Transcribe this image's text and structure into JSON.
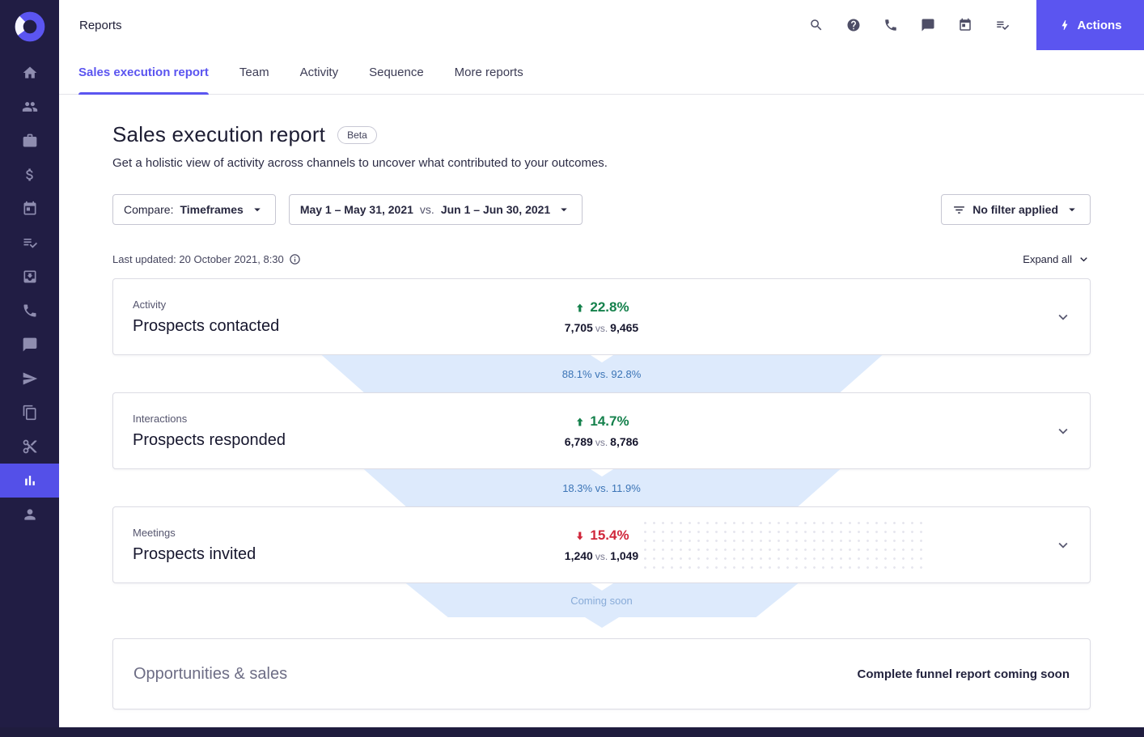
{
  "topbar": {
    "title": "Reports",
    "actions_label": "Actions"
  },
  "tabs": [
    {
      "label": "Sales execution report",
      "active": true
    },
    {
      "label": "Team",
      "active": false
    },
    {
      "label": "Activity",
      "active": false
    },
    {
      "label": "Sequence",
      "active": false
    },
    {
      "label": "More reports",
      "active": false
    }
  ],
  "page": {
    "title": "Sales execution report",
    "badge": "Beta",
    "subtitle": "Get a holistic view of activity across channels to uncover what contributed to your outcomes."
  },
  "filters": {
    "compare_label": "Compare:",
    "compare_value": "Timeframes",
    "timeframe_a": "May 1 – May 31, 2021",
    "vs": "vs.",
    "timeframe_b": "Jun 1 – Jun 30, 2021",
    "no_filter": "No filter applied"
  },
  "meta": {
    "last_updated": "Last updated: 20 October 2021, 8:30",
    "expand_all": "Expand all"
  },
  "funnel": {
    "stages": [
      {
        "category": "Activity",
        "title": "Prospects contacted",
        "direction": "up",
        "change": "22.8%",
        "value_a": "7,705",
        "vs": "vs.",
        "value_b": "9,465",
        "connector": "88.1% vs. 92.8%"
      },
      {
        "category": "Interactions",
        "title": "Prospects responded",
        "direction": "up",
        "change": "14.7%",
        "value_a": "6,789",
        "vs": "vs.",
        "value_b": "8,786",
        "connector": "18.3% vs. 11.9%"
      },
      {
        "category": "Meetings",
        "title": "Prospects invited",
        "direction": "down",
        "change": "15.4%",
        "value_a": "1,240",
        "vs": "vs.",
        "value_b": "1,049",
        "connector": "Coming soon"
      }
    ],
    "final": {
      "title": "Opportunities & sales",
      "note": "Complete funnel report coming soon"
    }
  },
  "icons": {
    "topbar": [
      "search-icon",
      "help-icon",
      "call-icon",
      "chat-icon",
      "calendar-icon",
      "tasks-icon",
      "lightning-bolt-icon"
    ],
    "sidebar": [
      "home-icon",
      "people-icon",
      "briefcase-icon",
      "dollar-icon",
      "calendar-icon",
      "tasks-icon",
      "inbox-icon",
      "phone-icon",
      "chat-icon",
      "send-icon",
      "copy-icon",
      "scissors-icon",
      "bar-chart-icon",
      "person-icon"
    ]
  },
  "colors": {
    "accent": "#5b55f0",
    "sidebar_bg": "#211d44",
    "active_nav_bg": "#5450e8",
    "positive": "#15814c",
    "negative": "#d0273b",
    "funnel_fill": "#ddeafc",
    "funnel_text": "#3b74b6"
  }
}
